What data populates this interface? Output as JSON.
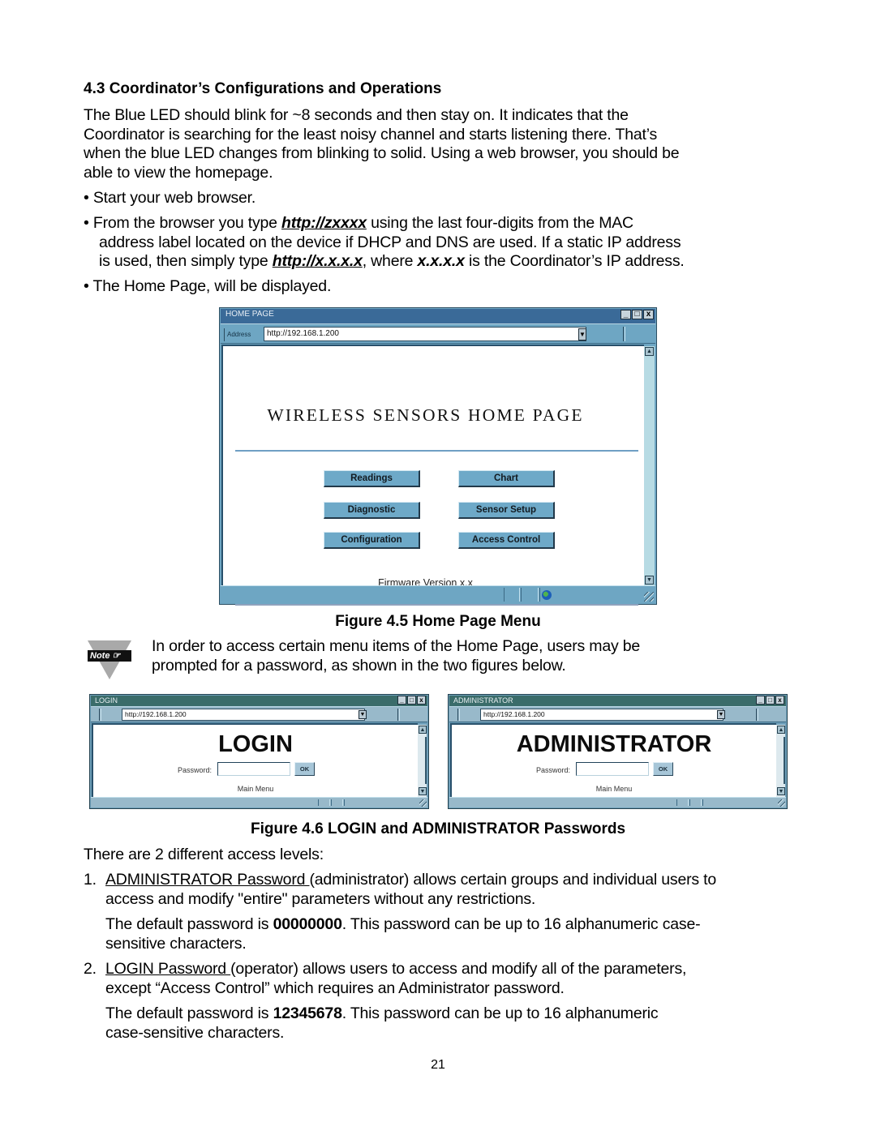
{
  "section": {
    "heading": "4.3  Coordinator’s Configurations and Operations",
    "intro_lines": [
      "The Blue LED should blink for ~8 seconds and then stay on. It indicates that the",
      "Coordinator is searching for the least noisy channel and starts listening there. That’s",
      "when the blue LED changes from blinking to solid.  Using a web browser, you should be",
      "able to view the homepage."
    ]
  },
  "bullets": {
    "b1": "Start your web browser.",
    "b2_pre": "From the browser you type ",
    "b2_link1": "http://zxxxx",
    "b2_post1": " using the last four-digits from the MAC",
    "b2_line2": "address label located on the device if DHCP and DNS are used.  If a static IP address",
    "b2_line3_pre": "is used, then simply type ",
    "b2_link2": "http://x.x.x.x",
    "b2_line3_mid": ", where ",
    "b2_ip": "x.x.x.x",
    "b2_line3_post": "  is the Coordinator’s IP address.",
    "b3": "The Home Page, will be displayed.",
    "bullet_char": "•"
  },
  "home_window": {
    "title": "HOME PAGE",
    "address_label": "Address",
    "address_value": "http://192.168.1.200",
    "page_title": "WIRELESS SENSORS HOME PAGE",
    "buttons": [
      "Readings",
      "Chart",
      "Diagnostic",
      "Sensor Setup",
      "Configuration",
      "Access Control"
    ],
    "firmware": "Firmware Version x.x",
    "controls": {
      "minimize": "_",
      "maximize": "□",
      "close": "x"
    },
    "scroll_up": "▲",
    "scroll_down": "▼",
    "dropdown": "▼",
    "status_icon": "globe-icon"
  },
  "figure_5_caption": "Figure 4.5  Home Page Menu",
  "note": {
    "badge": "Note ☞",
    "lines": [
      "In order to access certain menu items of the Home Page, users may be",
      "prompted for a password, as shown in the two figures below."
    ]
  },
  "login_window": {
    "title": "LOGIN",
    "address_value": "http://192.168.1.200",
    "heading": "LOGIN",
    "password_label": "Password:",
    "password_value": "",
    "ok_label": "OK",
    "main_menu": "Main Menu"
  },
  "admin_window": {
    "title": "ADMINISTRATOR",
    "address_value": "http://192.168.1.200",
    "heading": "ADMINISTRATOR",
    "password_label": "Password:",
    "password_value": "",
    "ok_label": "OK",
    "main_menu": "Main Menu"
  },
  "figure_6_caption": "Figure 4.6   LOGIN and ADMINISTRATOR Passwords",
  "access": {
    "intro": "There are 2 different access levels:",
    "item1": {
      "num": "1.",
      "term": "ADMINISTRATOR Password ",
      "rest": "(administrator) allows certain groups and individual users to",
      "line2": "access and modify \"entire\" parameters without any restrictions.",
      "default_pre": "The default password is ",
      "default_pw": "00000000",
      "default_post": ".  This password can be up to 16 alphanumeric case-",
      "default_line2": "sensitive characters."
    },
    "item2": {
      "num": "2.",
      "term": "LOGIN Password ",
      "rest": "(operator) allows users to access and modify all of the parameters,",
      "line2": "except “Access Control” which requires an Administrator password.",
      "default_pre": "The default password is ",
      "default_pw": "12345678",
      "default_post": ".  This password can be up to 16 alphanumeric",
      "default_line2": "case-sensitive characters."
    }
  },
  "page_number": "21"
}
